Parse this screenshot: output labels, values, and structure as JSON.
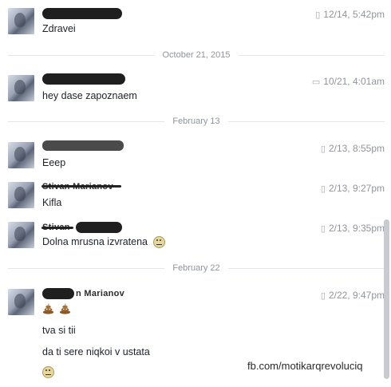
{
  "messages": [
    {
      "text": "Zdravei",
      "time": "12/14, 5:42pm"
    },
    {
      "text": "hey dase zapoznaem",
      "time": "10/21, 4:01am"
    },
    {
      "text": "Eeep",
      "time": "2/13, 8:55pm"
    },
    {
      "text": "Kifla",
      "time": "2/13, 9:27pm"
    },
    {
      "text": "Dolna mrusna izvratena",
      "time": "2/13, 9:35pm"
    },
    {
      "time": "2/22, 9:47pm",
      "lines": [
        "tva si tii",
        "da ti sere niqkoi v ustata"
      ]
    }
  ],
  "separators": [
    "October 21, 2015",
    "February 13",
    "February 22"
  ],
  "partial_names": {
    "m4": "Stivan Marianov",
    "m5": "Stivan",
    "m6": "n Marianov"
  },
  "watermark": "fb.com/motikarqrevoluciq",
  "icons": {
    "device": "phone-icon",
    "desktop": "computer-icon",
    "emoji": "smiley-emoji",
    "poop": "poop-emoji"
  }
}
